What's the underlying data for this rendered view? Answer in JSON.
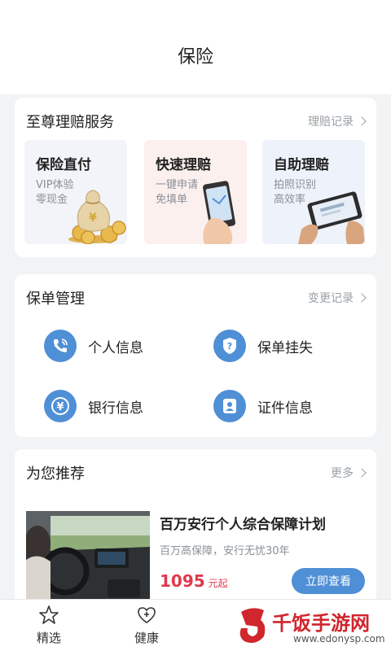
{
  "header": {
    "title": "保险"
  },
  "claims": {
    "title": "至尊理赔服务",
    "more": "理赔记录",
    "services": [
      {
        "name": "保险直付",
        "sub1": "VIP体验",
        "sub2": "零现金",
        "icon": "coins-bag-icon"
      },
      {
        "name": "快速理赔",
        "sub1": "一键申请",
        "sub2": "免填单",
        "icon": "phone-hand-icon"
      },
      {
        "name": "自助理赔",
        "sub1": "拍照识别",
        "sub2": "高效率",
        "icon": "phone-photo-icon"
      }
    ]
  },
  "policy": {
    "title": "保单管理",
    "more": "变更记录",
    "items": [
      {
        "label": "个人信息",
        "icon": "phone-call-icon"
      },
      {
        "label": "保单挂失",
        "icon": "shield-question-icon"
      },
      {
        "label": "银行信息",
        "icon": "yen-icon"
      },
      {
        "label": "证件信息",
        "icon": "id-person-icon"
      }
    ]
  },
  "recommend": {
    "title": "为您推荐",
    "more": "更多",
    "product": {
      "title": "百万安行个人综合保障计划",
      "subtitle": "百万高保障，安行无忧30年",
      "price": "1095",
      "unit": "元起",
      "button": "立即查看"
    }
  },
  "tabbar": {
    "tabs": [
      {
        "label": "精选",
        "icon": "star-icon"
      },
      {
        "label": "健康",
        "icon": "heart-plus-icon"
      }
    ]
  },
  "watermark": {
    "text": "千饭手游网",
    "url": "www.edonysp.com"
  },
  "colors": {
    "accent": "#4f8fd6",
    "price": "#e0394c",
    "background": "#f2f3f5"
  }
}
